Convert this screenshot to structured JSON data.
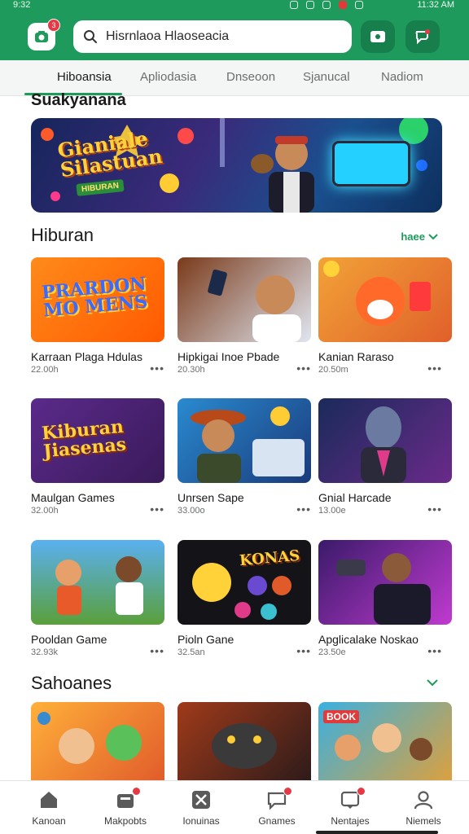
{
  "status_bar": {
    "time_left": "9:32",
    "time_right": "11:32 AM"
  },
  "header": {
    "notification_count": "3",
    "search_text": "Hisrnlaoa Hlaoseacia",
    "colors": {
      "brand": "#1e9a5c",
      "accent_red": "#e63946"
    }
  },
  "tabs": [
    {
      "label": "Hiboansia",
      "active": true
    },
    {
      "label": "Apliodasia",
      "active": false
    },
    {
      "label": "Dnseoon",
      "active": false
    },
    {
      "label": "Sjanucal",
      "active": false
    },
    {
      "label": "Nadiom",
      "active": false
    }
  ],
  "top_section": {
    "title": "Suakyanana",
    "banner_title": "Gianiale Silastuan",
    "banner_subtitle": "HIBURAN"
  },
  "section_hiburan": {
    "title": "Hiburan",
    "more_label": "haee",
    "cards": [
      {
        "title": "Karraan Plaga Hdulas",
        "meta": "22.00h",
        "thumb_text": "PRARDON MO MENS",
        "icon": "game-thumb"
      },
      {
        "title": "Hipkigai Inoe Pbade",
        "meta": "20.30h",
        "thumb_text": "",
        "icon": "selfie-thumb"
      },
      {
        "title": "Kanian Raraso",
        "meta": "20.50m",
        "thumb_text": "",
        "icon": "fox-thumb"
      },
      {
        "title": "Maulgan Games",
        "meta": "32.00h",
        "thumb_text": "Kiburan Jiasenas",
        "icon": "game-thumb"
      },
      {
        "title": "Unrsen Sape",
        "meta": "33.00o",
        "thumb_text": "",
        "icon": "cowboy-thumb"
      },
      {
        "title": "Gnial Harcade",
        "meta": "13.00e",
        "thumb_text": "",
        "icon": "wolf-thumb"
      },
      {
        "title": "Pooldan Game",
        "meta": "32.93k",
        "thumb_text": "",
        "icon": "kids-thumb"
      },
      {
        "title": "Pioln Gane",
        "meta": "32.5an",
        "thumb_text": "KONAS",
        "icon": "bear-thumb"
      },
      {
        "title": "Apglicalake Noskao",
        "meta": "23.50e",
        "thumb_text": "",
        "icon": "vr-thumb"
      }
    ]
  },
  "section_sahoanes": {
    "title": "Sahoanes",
    "cards": [
      {
        "icon": "cartoon-thumb"
      },
      {
        "icon": "dragon-thumb"
      },
      {
        "icon": "party-thumb",
        "thumb_text": "BOOK"
      }
    ]
  },
  "bottom_nav": [
    {
      "label": "Kanoan",
      "icon": "home-icon",
      "badge": false
    },
    {
      "label": "Makpobts",
      "icon": "store-icon",
      "badge": true
    },
    {
      "label": "Ionuinas",
      "icon": "tools-icon",
      "badge": false
    },
    {
      "label": "Gnames",
      "icon": "chat-icon",
      "badge": true
    },
    {
      "label": "Nentajes",
      "icon": "message-icon",
      "badge": true
    },
    {
      "label": "Niemels",
      "icon": "profile-icon",
      "badge": false
    }
  ]
}
